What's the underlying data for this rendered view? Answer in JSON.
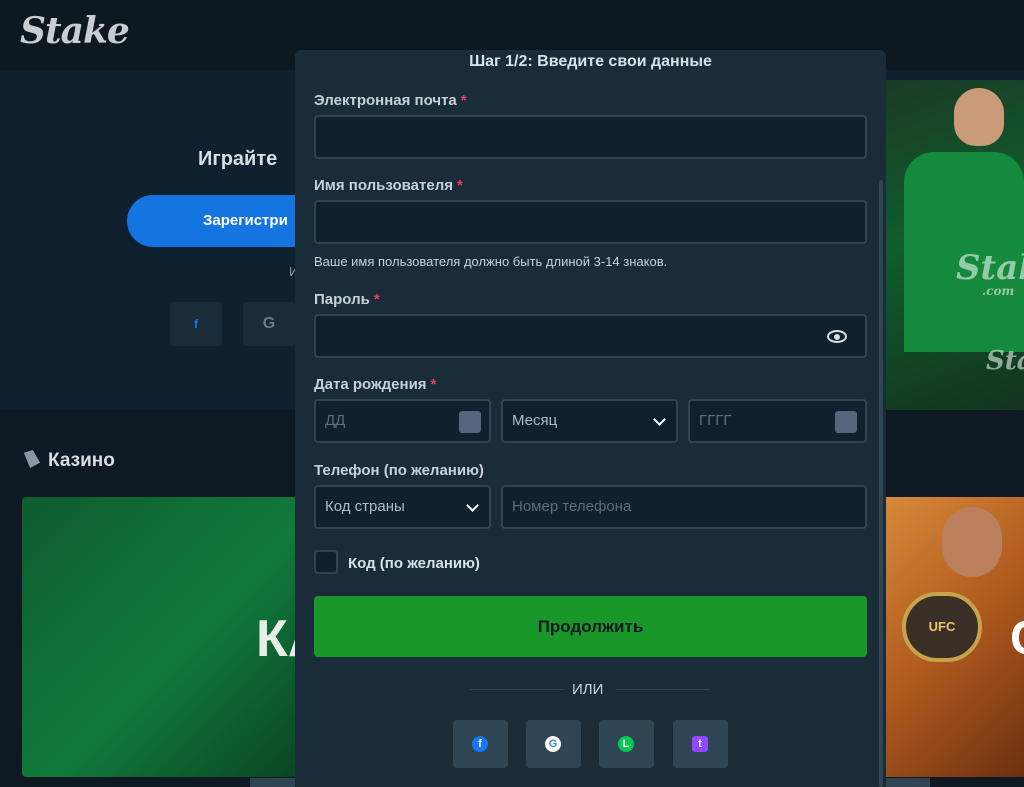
{
  "background": {
    "logo": "Stake",
    "hero_title": "Играйте",
    "register_button": "Зарегистри",
    "or_text": "И",
    "social_fb": "f",
    "social_google": "G",
    "casino_heading": "Казино",
    "casino_card_text": "КА",
    "right_card_text": "C",
    "watermark": "Stake",
    "watermark_sub": ".com",
    "belt_text": "UFC"
  },
  "modal": {
    "title": "Шаг 1/2: Введите свои данные",
    "email": {
      "label": "Электронная почта",
      "required": "*",
      "value": ""
    },
    "username": {
      "label": "Имя пользователя",
      "required": "*",
      "value": "",
      "hint": "Ваше имя пользователя должно быть длиной 3-14 знаков."
    },
    "password": {
      "label": "Пароль",
      "required": "*",
      "value": ""
    },
    "birthdate": {
      "label": "Дата рождения",
      "required": "*",
      "day_placeholder": "ДД",
      "month_placeholder": "Месяц",
      "year_placeholder": "ГГГГ"
    },
    "phone": {
      "label": "Телефон (по желанию)",
      "country_placeholder": "Код страны",
      "number_placeholder": "Номер телефона"
    },
    "code_checkbox_label": "Код (по желанию)",
    "continue_button": "Продолжить",
    "or_divider": "ИЛИ",
    "social": [
      {
        "name": "facebook",
        "glyph": "f"
      },
      {
        "name": "google",
        "glyph": "G"
      },
      {
        "name": "line",
        "glyph": "L"
      },
      {
        "name": "twitch",
        "glyph": "t"
      }
    ]
  },
  "colors": {
    "accent_green": "#1a9729",
    "panel": "#1a2c38",
    "field": "#0f212e",
    "border": "#2f4553",
    "required_red": "#e5405e"
  }
}
